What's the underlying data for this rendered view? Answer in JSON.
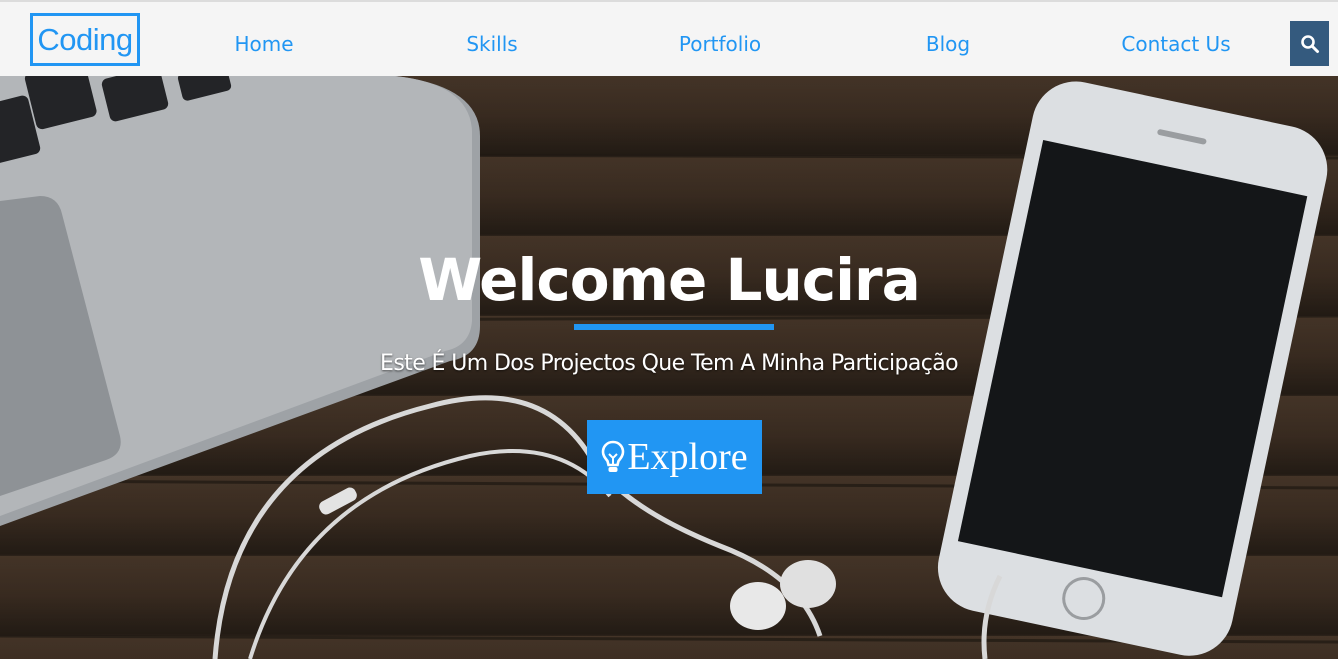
{
  "header": {
    "logo": "Coding",
    "nav": [
      {
        "label": "Home"
      },
      {
        "label": "Skills"
      },
      {
        "label": "Portfolio"
      },
      {
        "label": "Blog"
      },
      {
        "label": "Contact Us"
      }
    ],
    "search_icon": "search-icon"
  },
  "hero": {
    "title": "Welcome Lucira",
    "subtitle": "Este É Um Dos Projectos Que Tem A Minha Participação",
    "button_label": "Explore",
    "button_icon": "lightbulb-icon",
    "background": "desk with laptop, smartphone and earphones"
  },
  "colors": {
    "accent": "#2196f3",
    "search_button": "#345a7e",
    "navbar_bg": "#f5f5f5"
  }
}
